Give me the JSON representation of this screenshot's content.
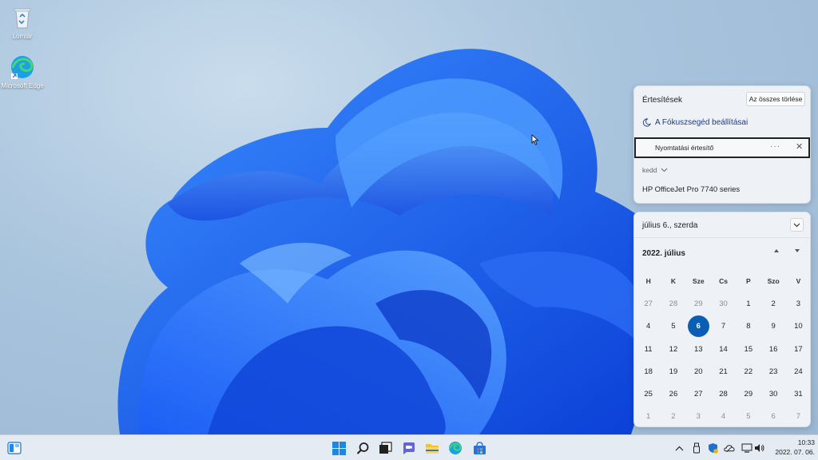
{
  "desktop": {
    "icons": [
      {
        "name": "recycle-bin",
        "label": "Lomtár"
      },
      {
        "name": "edge",
        "label": "Microsoft Edge"
      }
    ]
  },
  "notifications": {
    "title": "Értesítések",
    "clear_all": "Az összes törlése",
    "focus_assist": "A Fókuszsegéd beállításai",
    "card_label": "Nyomtatási értesítő",
    "more": "···",
    "close": "✕",
    "group_day": "kedd",
    "printer_name": "HP OfficeJet Pro 7740 series"
  },
  "calendar": {
    "header_date": "július 6., szerda",
    "month_label": "2022. július",
    "weekdays": [
      "H",
      "K",
      "Sze",
      "Cs",
      "P",
      "Szo",
      "V"
    ],
    "days": [
      {
        "d": "27",
        "other": true
      },
      {
        "d": "28",
        "other": true
      },
      {
        "d": "29",
        "other": true
      },
      {
        "d": "30",
        "other": true
      },
      {
        "d": "1"
      },
      {
        "d": "2"
      },
      {
        "d": "3"
      },
      {
        "d": "4"
      },
      {
        "d": "5"
      },
      {
        "d": "6",
        "today": true
      },
      {
        "d": "7"
      },
      {
        "d": "8"
      },
      {
        "d": "9"
      },
      {
        "d": "10"
      },
      {
        "d": "11"
      },
      {
        "d": "12"
      },
      {
        "d": "13"
      },
      {
        "d": "14"
      },
      {
        "d": "15"
      },
      {
        "d": "16"
      },
      {
        "d": "17"
      },
      {
        "d": "18"
      },
      {
        "d": "19"
      },
      {
        "d": "20"
      },
      {
        "d": "21"
      },
      {
        "d": "22"
      },
      {
        "d": "23"
      },
      {
        "d": "24"
      },
      {
        "d": "25"
      },
      {
        "d": "26"
      },
      {
        "d": "27"
      },
      {
        "d": "28"
      },
      {
        "d": "29"
      },
      {
        "d": "30"
      },
      {
        "d": "31"
      },
      {
        "d": "1",
        "other": true
      },
      {
        "d": "2",
        "other": true
      },
      {
        "d": "3",
        "other": true
      },
      {
        "d": "4",
        "other": true
      },
      {
        "d": "5",
        "other": true
      },
      {
        "d": "6",
        "other": true
      },
      {
        "d": "7",
        "other": true
      }
    ],
    "accent_color": "#0a5fb4"
  },
  "taskbar": {
    "pinned": [
      "widgets-icon",
      "start-icon",
      "search-icon",
      "task-view-icon",
      "chat-icon",
      "file-explorer-icon",
      "edge-icon",
      "store-icon"
    ],
    "tray": [
      "chevron-up-icon",
      "usb-icon",
      "security-icon",
      "onedrive-icon",
      "network-icon",
      "volume-icon"
    ],
    "time": "10:33",
    "date": "2022. 07. 06."
  }
}
